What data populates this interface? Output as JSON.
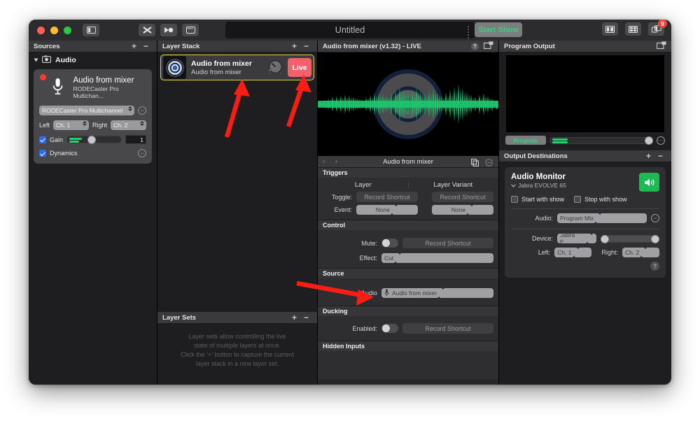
{
  "window": {
    "title": "Untitled",
    "start_show_label": "Start Show",
    "notification_badge": "9"
  },
  "sources_panel": {
    "header": "Sources",
    "add_label": "+",
    "remove_label": "−",
    "group": {
      "label": "Audio",
      "icon": "camera-icon"
    },
    "card": {
      "title": "Audio from mixer",
      "subtitle": "RODECaster Pro Multichan...",
      "device_select": "RODECaster Pro Multichannel",
      "left_label": "Left",
      "left_value": "Ch. 1",
      "right_label": "Right",
      "right_value": "Ch. 2",
      "gain_label": "Gain",
      "gain_value": "1",
      "dynamics_label": "Dynamics"
    }
  },
  "layer_stack": {
    "header": "Layer Stack",
    "add_label": "+",
    "remove_label": "−",
    "item": {
      "title": "Audio from mixer",
      "subtitle": "Audio from mixer",
      "live_label": "Live"
    }
  },
  "layer_sets": {
    "header": "Layer Sets",
    "add_label": "+",
    "remove_label": "−",
    "empty_text_line1": "Layer sets allow controlling the live",
    "empty_text_line2": "state of multiple layers at once.",
    "empty_text_line3": "Click the ‘+’ button to capture the current",
    "empty_text_line4": "layer stack in a new layer set."
  },
  "inspector": {
    "header": "Audio from mixer (v1.32) - LIVE",
    "help_label": "?",
    "nav_title": "Audio from mixer",
    "prev_label": "‹",
    "next_label": "›",
    "triggers": {
      "header": "Triggers",
      "col_layer": "Layer",
      "col_layer_variant": "Layer Variant",
      "toggle_label": "Toggle:",
      "toggle_layer_value": "Record Shortcut",
      "toggle_variant_value": "Record Shortcut",
      "event_label": "Event:",
      "event_layer_value": "None",
      "event_variant_value": "None"
    },
    "control": {
      "header": "Control",
      "mute_label": "Mute:",
      "mute_shortcut": "Record Shortcut",
      "effect_label": "Effect:",
      "effect_value": "Cut"
    },
    "source": {
      "header": "Source",
      "audio_label": "Audio",
      "audio_value": "Audio from mixer"
    },
    "ducking": {
      "header": "Ducking",
      "enabled_label": "Enabled:",
      "enabled_shortcut": "Record Shortcut"
    },
    "hidden_inputs": {
      "header": "Hidden Inputs"
    }
  },
  "program_output": {
    "header": "Program Output",
    "program_label": "Program"
  },
  "output_destinations": {
    "header": "Output Destinations",
    "add_label": "+",
    "remove_label": "−",
    "card": {
      "title": "Audio Monitor",
      "device_name": "Jabra EVOLVE 65",
      "start_with_show": "Start with show",
      "stop_with_show": "Stop with show",
      "audio_label": "Audio:",
      "audio_value": "Program Mix",
      "device_label": "Device:",
      "device_value": "Jabra E...",
      "left_label": "Left:",
      "left_value": "Ch. 1",
      "right_label": "Right:",
      "right_value": "Ch. 2",
      "help_label": "?"
    }
  },
  "annotations": {
    "arrow_color": "#f91d13",
    "arrows": [
      {
        "name": "arrow-to-layer-item"
      },
      {
        "name": "arrow-to-live-button"
      },
      {
        "name": "arrow-to-audio-source"
      }
    ]
  },
  "colors": {
    "live": "#f4606a",
    "accent_green": "#35d07f",
    "selection": "#d8d83c",
    "badge_red": "#e8453c"
  }
}
